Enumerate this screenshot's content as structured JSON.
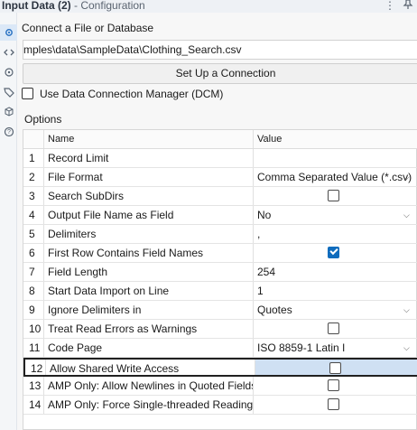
{
  "window": {
    "title": "Input Data (2)",
    "subtitle": "- Configuration",
    "toolbar_icons": [
      "more-icon",
      "pin-icon"
    ]
  },
  "sidebar": {
    "icons": [
      "gear-icon",
      "code-icon",
      "settings-icon",
      "tag-icon",
      "cube-icon",
      "help-icon"
    ]
  },
  "connect": {
    "label": "Connect a File or Database",
    "path_value": "mples\\data\\SampleData\\Clothing_Search.csv",
    "button_label": "Set Up a Connection"
  },
  "dcm": {
    "label": "Use Data Connection Manager (DCM)",
    "checked": false
  },
  "options": {
    "label": "Options",
    "header": {
      "name": "Name",
      "value": "Value"
    },
    "rows": [
      {
        "num": "1",
        "name": "Record Limit",
        "value": "",
        "kind": "text"
      },
      {
        "num": "2",
        "name": "File Format",
        "value": "Comma Separated Value (*.csv)",
        "kind": "dropdown"
      },
      {
        "num": "3",
        "name": "Search SubDirs",
        "value": "",
        "kind": "checkbox",
        "checked": false
      },
      {
        "num": "4",
        "name": "Output File Name as Field",
        "value": "No",
        "kind": "dropdown"
      },
      {
        "num": "5",
        "name": "Delimiters",
        "value": ",",
        "kind": "text"
      },
      {
        "num": "6",
        "name": "First Row Contains Field Names",
        "value": "",
        "kind": "checkbox",
        "checked": true
      },
      {
        "num": "7",
        "name": "Field Length",
        "value": "254",
        "kind": "text"
      },
      {
        "num": "8",
        "name": "Start Data Import on Line",
        "value": "1",
        "kind": "text"
      },
      {
        "num": "9",
        "name": "Ignore Delimiters in",
        "value": "Quotes",
        "kind": "dropdown"
      },
      {
        "num": "10",
        "name": "Treat Read Errors as Warnings",
        "value": "",
        "kind": "checkbox",
        "checked": false
      },
      {
        "num": "11",
        "name": "Code Page",
        "value": "ISO 8859-1 Latin I",
        "kind": "dropdown"
      },
      {
        "num": "12",
        "name": "Allow Shared Write Access",
        "value": "",
        "kind": "checkbox",
        "checked": false,
        "selected": true
      },
      {
        "num": "13",
        "name": "AMP Only: Allow Newlines in Quoted Fields",
        "value": "",
        "kind": "checkbox",
        "checked": false
      },
      {
        "num": "14",
        "name": "AMP Only: Force Single-threaded Reading",
        "value": "",
        "kind": "checkbox",
        "checked": false
      }
    ]
  },
  "colors": {
    "accent": "#0f6cbd",
    "selection": "#cfe0f3"
  }
}
